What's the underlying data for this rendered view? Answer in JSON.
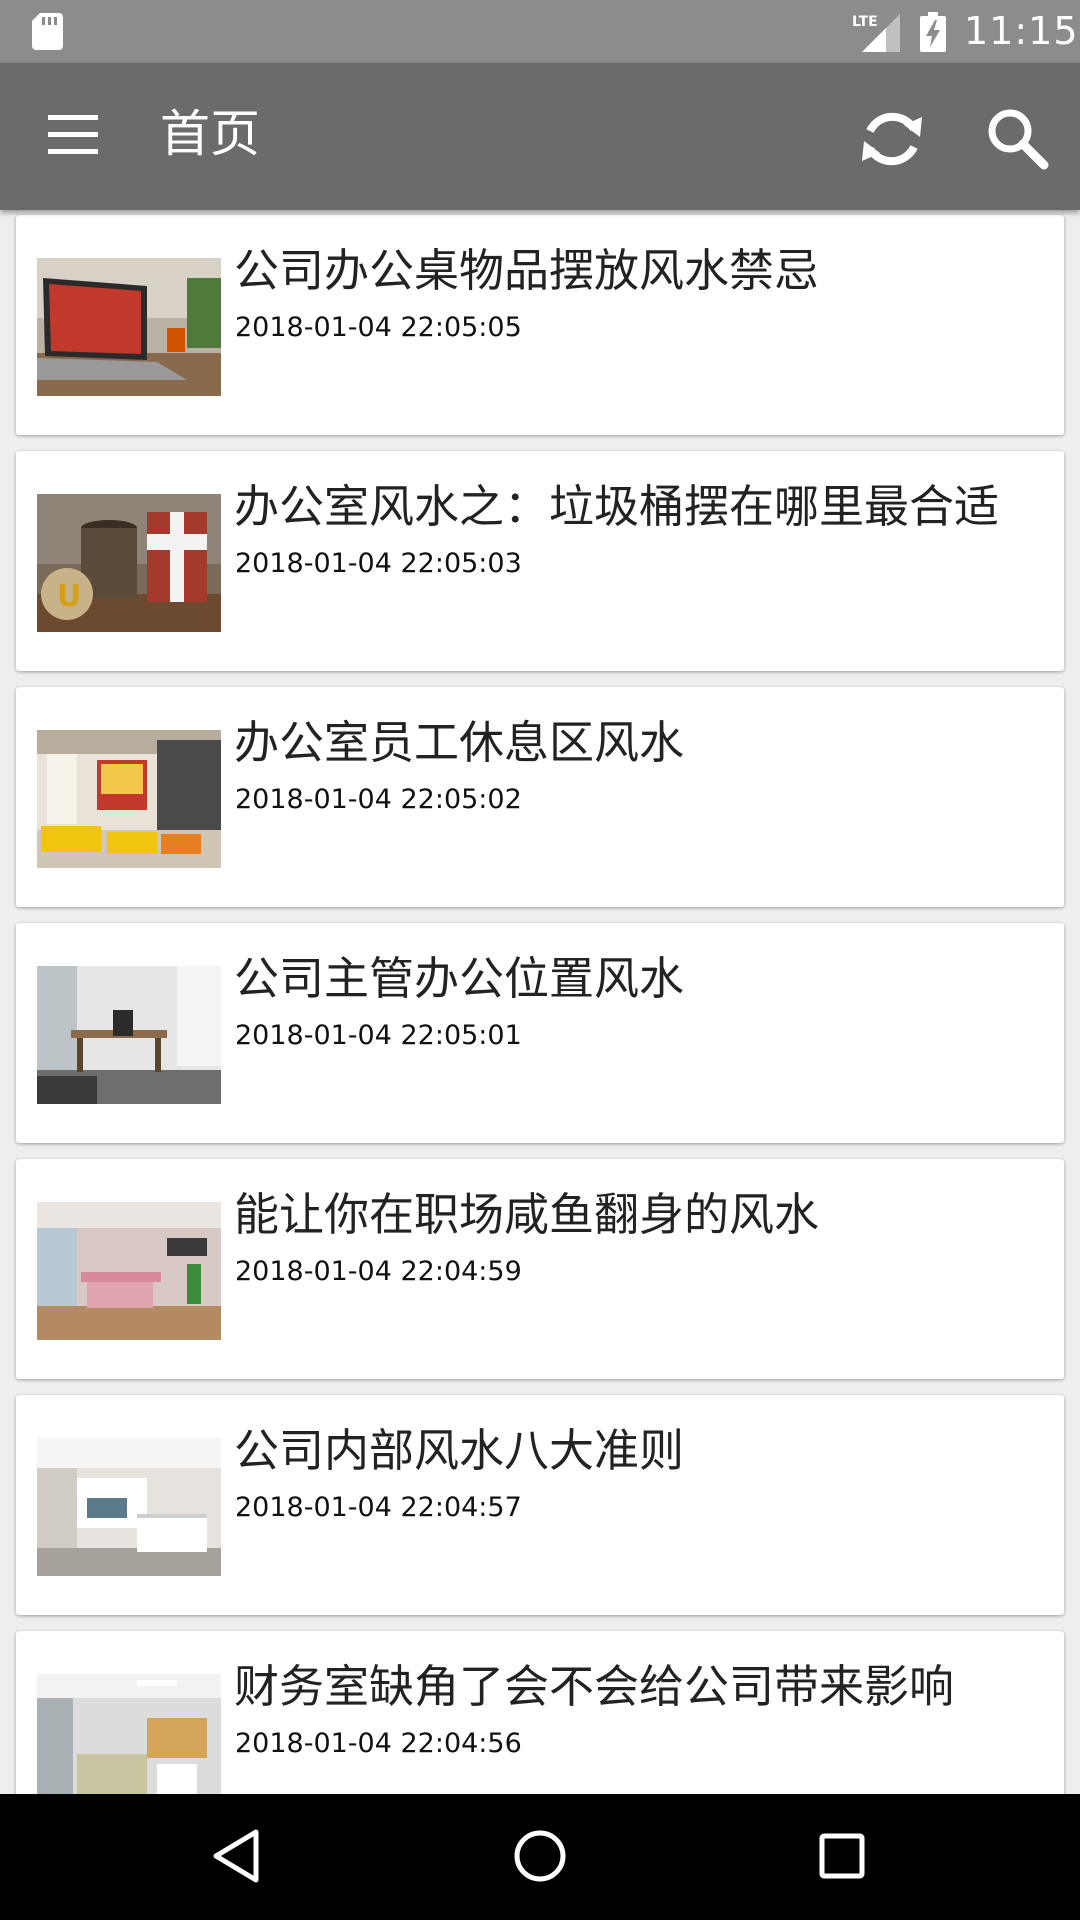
{
  "status_bar": {
    "time": "11:15",
    "network_label": "LTE",
    "icons": [
      "sd-card-icon",
      "signal-icon",
      "battery-charging-icon"
    ]
  },
  "app_bar": {
    "title": "首页",
    "icons": [
      "menu-icon",
      "refresh-icon",
      "search-icon"
    ]
  },
  "articles": [
    {
      "title": "公司办公桌物品摆放风水禁忌",
      "time": "2018-01-04 22:05:05",
      "thumbnail": "laptop-desk-photo"
    },
    {
      "title": "办公室风水之：垃圾桶摆在哪里最合适",
      "time": "2018-01-04 22:05:03",
      "thumbnail": "trash-bins-photo"
    },
    {
      "title": "办公室员工休息区风水",
      "time": "2018-01-04 22:05:02",
      "thumbnail": "lounge-area-photo"
    },
    {
      "title": "公司主管办公位置风水",
      "time": "2018-01-04 22:05:01",
      "thumbnail": "manager-office-photo"
    },
    {
      "title": "能让你在职场咸鱼翻身的风水",
      "time": "2018-01-04 22:04:59",
      "thumbnail": "open-office-photo"
    },
    {
      "title": "公司内部风水八大准则",
      "time": "2018-01-04 22:04:57",
      "thumbnail": "reception-area-photo"
    },
    {
      "title": "财务室缺角了会不会给公司带来影响",
      "time": "2018-01-04 22:04:56",
      "thumbnail": "finance-room-photo"
    }
  ],
  "nav_bar": {
    "icons": [
      "back-icon",
      "home-icon",
      "recent-apps-icon"
    ]
  },
  "colors": {
    "status_bar": "#8c8c8c",
    "app_bar": "#6b6b6b",
    "background": "#eeeeee",
    "card": "#ffffff",
    "nav_bar": "#000000"
  }
}
